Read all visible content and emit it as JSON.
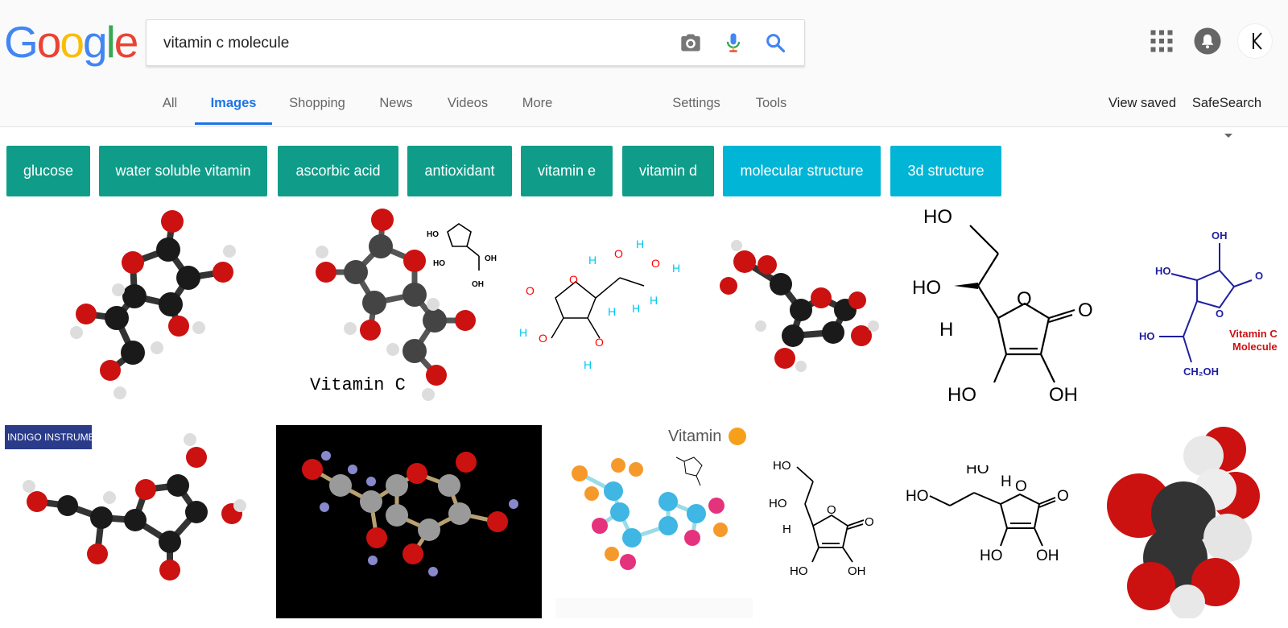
{
  "logo": {
    "letters": [
      "G",
      "o",
      "o",
      "g",
      "l",
      "e"
    ],
    "colors": [
      "#4285F4",
      "#EA4335",
      "#FBBC05",
      "#4285F4",
      "#34A853",
      "#EA4335"
    ]
  },
  "search": {
    "value": "vitamin c molecule",
    "camera_icon": "camera-icon",
    "mic_icon": "microphone-icon",
    "search_icon": "search-icon"
  },
  "header_right": {
    "apps_icon": "apps-grid-icon",
    "notifications_icon": "notifications-bell-icon",
    "avatar_letter": "K"
  },
  "tabs": [
    {
      "label": "All",
      "active": false
    },
    {
      "label": "Images",
      "active": true
    },
    {
      "label": "Shopping",
      "active": false
    },
    {
      "label": "News",
      "active": false
    },
    {
      "label": "Videos",
      "active": false
    },
    {
      "label": "More",
      "active": false
    },
    {
      "label": "Settings",
      "active": false
    },
    {
      "label": "Tools",
      "active": false
    }
  ],
  "right_tabs": {
    "view_saved": "View saved",
    "safesearch": "SafeSearch"
  },
  "chips": [
    {
      "label": "glucose",
      "color": "#0f9d8a"
    },
    {
      "label": "water soluble vitamin",
      "color": "#0f9d8a"
    },
    {
      "label": "ascorbic acid",
      "color": "#0f9d8a"
    },
    {
      "label": "antioxidant",
      "color": "#0f9d8a"
    },
    {
      "label": "vitamin e",
      "color": "#0f9d8a"
    },
    {
      "label": "vitamin d",
      "color": "#0f9d8a"
    },
    {
      "label": "molecular structure",
      "color": "#00b5d6"
    },
    {
      "label": "3d structure",
      "color": "#00b5d6"
    }
  ],
  "results": {
    "row1": [
      {
        "caption": ""
      },
      {
        "caption": "Vitamin C"
      },
      {
        "caption": ""
      },
      {
        "caption": ""
      },
      {
        "caption": ""
      },
      {
        "caption": "Vitamin C Molecule"
      }
    ],
    "row2": [
      {
        "caption": "INDIGO INSTRUMENTS"
      },
      {
        "caption": ""
      },
      {
        "caption": "Vitamin"
      },
      {
        "caption": ""
      },
      {
        "caption": ""
      },
      {
        "caption": ""
      }
    ]
  }
}
